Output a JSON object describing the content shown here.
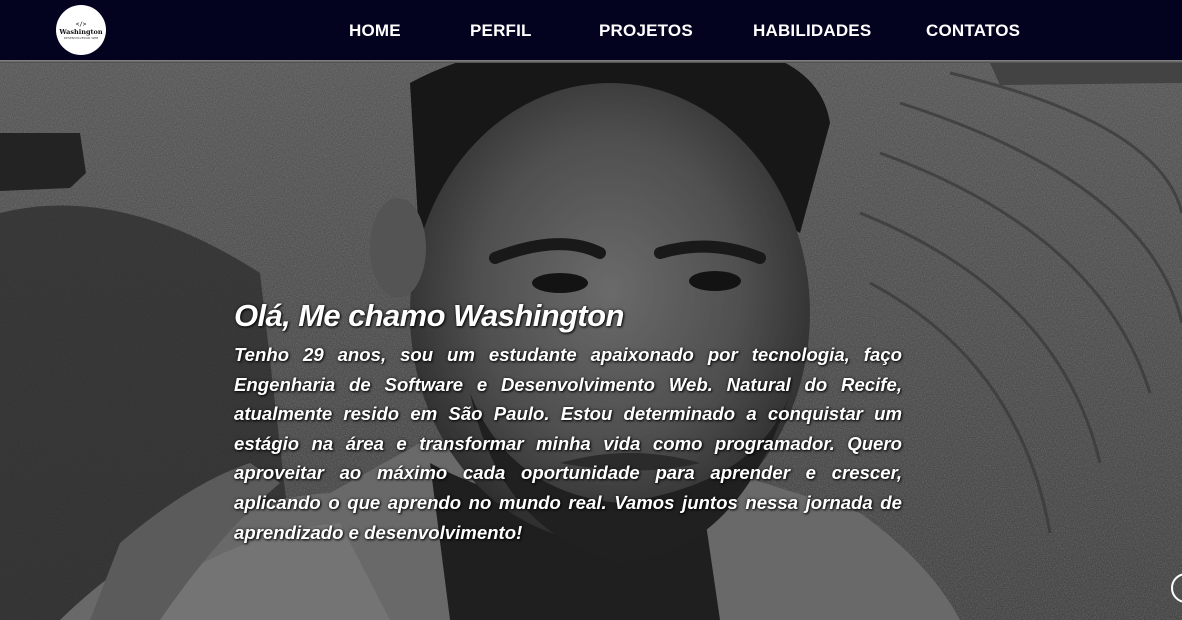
{
  "header": {
    "logo": {
      "mark": "</>",
      "name": "Washington",
      "subtitle": "DESENVOLVEDOR WEB",
      "icon": "code-brackets-icon"
    },
    "nav": [
      {
        "label": "HOME"
      },
      {
        "label": "PERFIL"
      },
      {
        "label": "PROJETOS"
      },
      {
        "label": "HABILIDADES"
      },
      {
        "label": "CONTATOS"
      }
    ],
    "colors": {
      "background": "#03021f",
      "text": "#ffffff"
    }
  },
  "hero": {
    "title": "Olá, Me chamo Washington",
    "paragraph": "Tenho 29 anos, sou um estudante apaixonado por tecnologia, faço Engenharia de Software e Desenvolvimento Web. Natural do Recife, atualmente resido em São Paulo. Estou determinado a conquistar um estágio na área e transformar minha vida como programador. Quero aproveitar ao máximo cada oportunidade para aprender e crescer, aplicando o que aprendo no mundo real. Vamos juntos nessa jornada de aprendizado e desenvolvimento!",
    "background_photo": "grayscale-selfie-photo",
    "scroll_icon": "circle-scroll-icon"
  }
}
